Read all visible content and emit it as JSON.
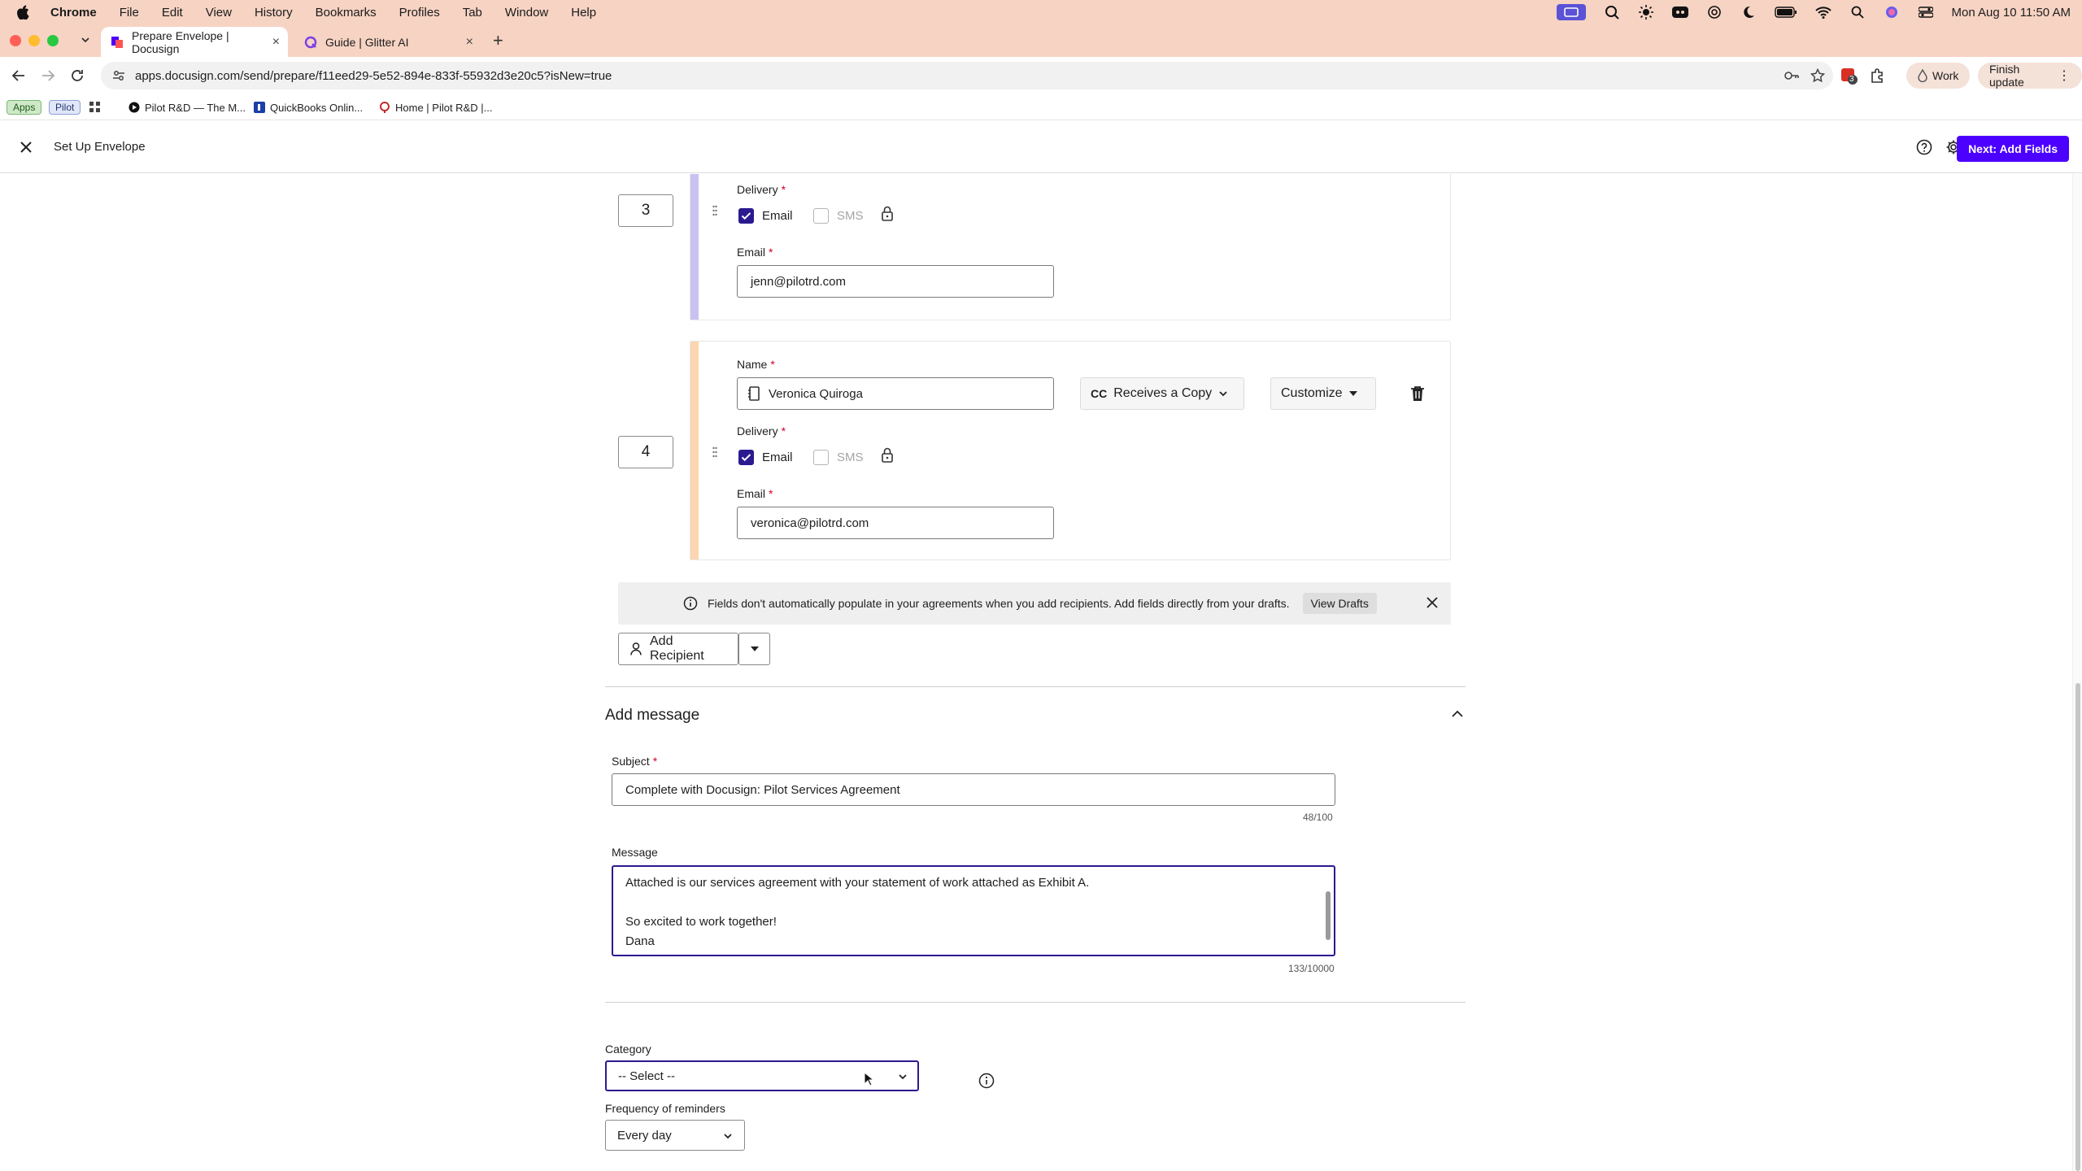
{
  "menubar": {
    "apple": "",
    "items": [
      "Chrome",
      "File",
      "Edit",
      "View",
      "History",
      "Bookmarks",
      "Profiles",
      "Tab",
      "Window",
      "Help"
    ],
    "clock": "Mon Aug 10  11:50 AM",
    "ask_gemini": "Ask Gemini"
  },
  "tabs": [
    {
      "title": "Prepare Envelope | Docusign",
      "active": true
    },
    {
      "title": "Guide | Glitter AI",
      "active": false
    }
  ],
  "toolbar": {
    "url": "apps.docusign.com/send/prepare/f11eed29-5e52-894e-833f-55932d3e20c5?isNew=true",
    "extension_badge": "3",
    "profile_label": "Work",
    "finish_update": "Finish update"
  },
  "bookmarks": {
    "apps": "Apps",
    "pilot": "Pilot",
    "items": [
      "Pilot R&D — The M...",
      "QuickBooks Onlin...",
      "Home | Pilot R&D |..."
    ]
  },
  "header": {
    "title": "Set Up Envelope",
    "next_label": "Next: Add Fields"
  },
  "recipients": [
    {
      "order": "3",
      "delivery_label": "Delivery",
      "email_option": "Email",
      "sms_option": "SMS",
      "email_label": "Email",
      "email": "jenn@pilotrd.com",
      "accent": "#c9c2f0"
    },
    {
      "order": "4",
      "name_label": "Name",
      "name": "Veronica Quiroga",
      "role_prefix": "CC",
      "role": "Receives a Copy",
      "customize": "Customize",
      "delivery_label": "Delivery",
      "email_option": "Email",
      "sms_option": "SMS",
      "email_label": "Email",
      "email": "veronica@pilotrd.com",
      "accent": "#fcd6b0"
    }
  ],
  "notice": {
    "text": "Fields don't automatically populate in your agreements when you add recipients. Add fields directly from your drafts.",
    "link": "View Drafts"
  },
  "add_recipient": "Add Recipient",
  "message_section": {
    "title": "Add message",
    "subject_label": "Subject",
    "subject": "Complete with Docusign: Pilot Services Agreement",
    "subject_count": "48/100",
    "message_label": "Message",
    "message_lines": [
      "Attached is our services agreement with your statement of work attached as Exhibit A.",
      "",
      "So excited to work together!",
      "Dana"
    ],
    "message_count": "133/10000"
  },
  "category": {
    "label": "Category",
    "value": "-- Select --"
  },
  "reminders": {
    "label": "Frequency of reminders",
    "value": "Every day"
  },
  "colors": {
    "primary": "#4c00ff",
    "checkbox": "#2b1a8f",
    "required": "#d4002a"
  }
}
